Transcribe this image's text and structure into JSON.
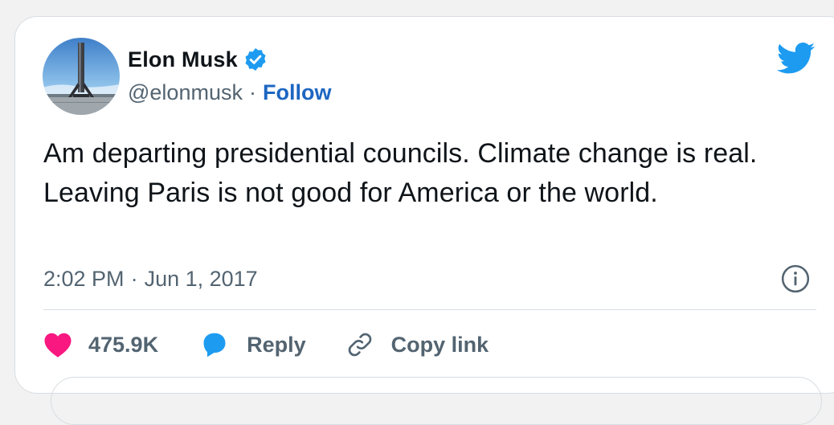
{
  "tweet": {
    "author_name": "Elon Musk",
    "handle": "@elonmusk",
    "separator": "·",
    "follow_label": "Follow",
    "text": "Am departing presidential councils. Climate change is real. Leaving Paris is not good for America or the world.",
    "time": "2:02 PM",
    "date": "Jun 1, 2017",
    "likes": "475.9K",
    "reply_label": "Reply",
    "copy_link_label": "Copy link"
  },
  "icons": {
    "verified": "verified-badge-icon",
    "platform": "twitter-bird-icon",
    "info": "info-icon",
    "like": "heart-icon",
    "reply": "speech-bubble-icon",
    "copy": "link-icon"
  },
  "colors": {
    "brand_blue": "#1d9bf0",
    "follow_blue": "#1d66c2",
    "like_pink": "#f91880",
    "text_primary": "#0f1419",
    "text_secondary": "#536471"
  }
}
